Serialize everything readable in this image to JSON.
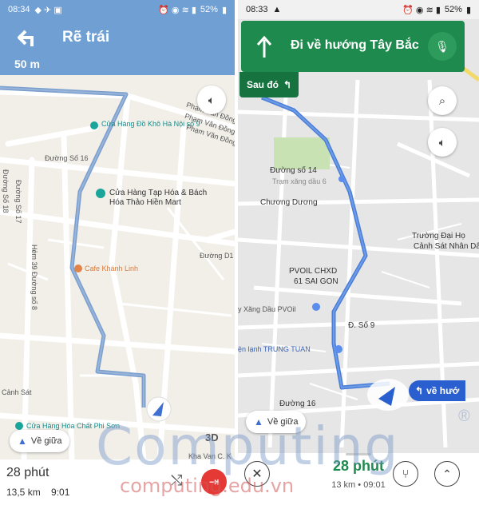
{
  "left": {
    "status": {
      "time": "08:34",
      "battery": "52%"
    },
    "nav": {
      "instruction": "Rẽ trái",
      "distance": "50 m"
    },
    "map_labels": {
      "shop1": "Cửa Hàng Đồ Khô Hà Nội số 9",
      "street_pvd1": "Phạm Văn Đồng",
      "street_pvd2": "Phạm Văn Đồng",
      "street_pvd3": "Phạm Văn Đồng",
      "duong16": "Đường Số 16",
      "duong17": "Đường Số 17",
      "duong18": "Đường Số 18",
      "shop2_line1": "Cửa Hàng Tạp Hóa & Bách",
      "shop2_line2": "Hóa Thảo Hiền Mart",
      "hem39": "Hẻm 39 Đường số 8",
      "cafe": "Cafe Khánh Linh",
      "duongd1": "Đường D1",
      "canhsat": "Cảnh Sát",
      "shop3": "Cửa Hàng Hóa Chất Phi Sơn",
      "khavan": "Kha Van C. K"
    },
    "buttons": {
      "recenter": "Về giữa",
      "view3d": "3D"
    },
    "bottom": {
      "duration": "28 phút",
      "distance": "13,5 km",
      "eta": "9:01"
    }
  },
  "right": {
    "status": {
      "time": "08:33",
      "battery": "52%"
    },
    "nav": {
      "instruction": "Đi về hướng Tây Bắc",
      "then_label": "Sau đó"
    },
    "map_labels": {
      "duong14": "Đường số 14",
      "tramxang6": "Trạm xăng dầu 6",
      "chuongduong": "Chương Dương",
      "truong1": "Trường Đại Họ",
      "truong2": "Cảnh Sát Nhân Dâ",
      "pvoil1": "PVOIL CHXD",
      "pvoil2": "61 SAI GON",
      "xangdau": "y Xăng Dầu PVOil",
      "dso9": "Đ. Số 9",
      "trungtuan": "ện lạnh TRUNG TUAN",
      "duong16": "Đường 16"
    },
    "buttons": {
      "recenter": "Về giữa",
      "next_turn": "về hướ"
    },
    "bottom": {
      "duration": "28 phút",
      "distance": "13 km",
      "eta": "09:01"
    }
  },
  "watermark": {
    "text": "Computing",
    "sub": "computing.edu.vn",
    "reg": "®"
  }
}
